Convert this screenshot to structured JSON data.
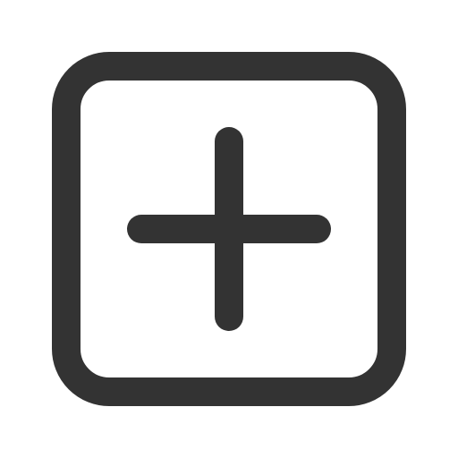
{
  "icon": {
    "name": "plus-square-icon",
    "stroke_color": "#333333",
    "background_color": "#ffffff"
  }
}
